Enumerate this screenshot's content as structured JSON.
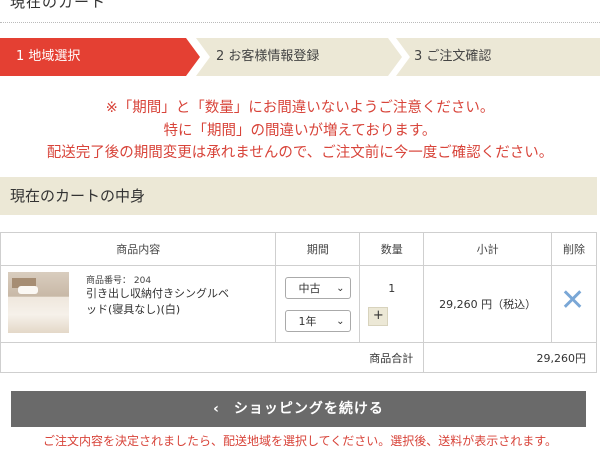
{
  "page": {
    "title": "現在のカート"
  },
  "steps": [
    {
      "label": "1 地域選択"
    },
    {
      "label": "2 お客様情報登録"
    },
    {
      "label": "3 ご注文確認"
    }
  ],
  "warnings": [
    "※「期間」と「数量」にお間違いないようご注意ください。",
    "特に「期間」の間違いが増えております。",
    "配送完了後の期間変更は承れませんので、ご注文前に今一度ご確認ください。"
  ],
  "cart": {
    "heading": "現在のカートの中身",
    "columns": [
      "商品内容",
      "期間",
      "数量",
      "小計",
      "削除"
    ],
    "items": [
      {
        "item_no": "商品番号： 204",
        "name": "引き出し収納付きシングルベッド(寝具なし)(白)",
        "condition_select": "中古",
        "period_select": "1年",
        "quantity": "1",
        "plus_label": "+",
        "subtotal": "29,260 円（税込）"
      }
    ],
    "total_label": "商品合計",
    "total_value": "29,260円"
  },
  "continue_button": {
    "arrow": "‹",
    "label": "ショッピングを続ける"
  },
  "bottom_note": "ご注文内容を決定されましたら、配送地域を選択してください。選択後、送料が表示されます。",
  "colors": {
    "accent_red": "#e44033",
    "step_bg": "#ece8d6",
    "delete_blue": "#7aa7d6",
    "button_gray": "#6a6a6a"
  }
}
